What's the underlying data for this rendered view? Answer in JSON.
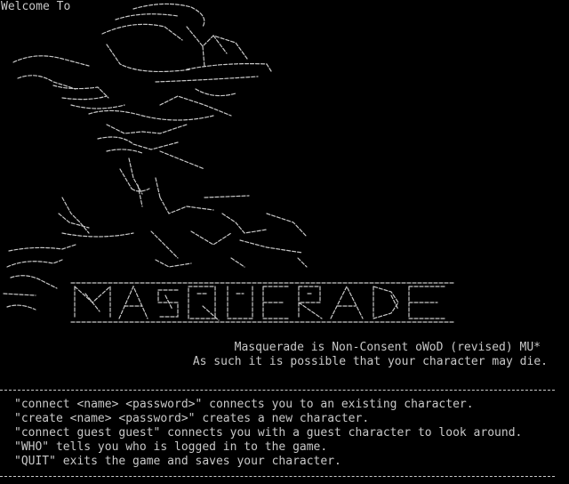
{
  "terminal": {
    "background": "#000000",
    "foreground": "#c8c8c8",
    "welcome": "Welcome To",
    "logo_text": "MASQUERADE",
    "tagline_1": "Masquerade is Non-Consent oWoD (revised) MU*",
    "tagline_2": "As such it is possible that your character may die.",
    "commands": [
      "\"connect <name> <password>\" connects you to an existing character.",
      "\"create <name> <password>\" creates a new character.",
      "\"connect guest guest\" connects you with a guest character to look around.",
      "\"WHO\" tells you who is logged in to the game.",
      "\"QUIT\" exits the game and saves your character."
    ]
  }
}
